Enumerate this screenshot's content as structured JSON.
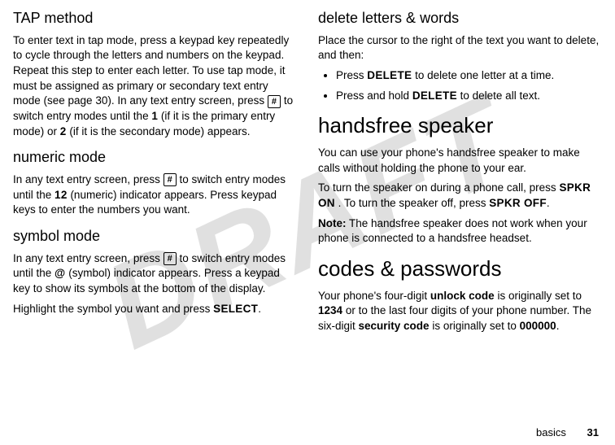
{
  "watermark": "DRAFT",
  "left": {
    "h_tap": "TAP method",
    "tap_para_a": "To enter text in tap mode, press a keypad key repeatedly to cycle through the letters and numbers on the keypad. Repeat this step to enter each letter. To use tap mode, it must be assigned as primary or secondary text entry mode (see page 30). In any text entry screen, press ",
    "key_hash": "#",
    "tap_para_b": " to switch entry modes until the ",
    "disp_1": "1",
    "tap_para_c": " (if it is the primary entry mode) or ",
    "disp_2": "2",
    "tap_para_d": " (if it is the secondary mode) appears.",
    "h_num": "numeric mode",
    "num_a": "In any text entry screen, press ",
    "num_b": " to switch entry modes until the ",
    "disp_12": "12",
    "num_c": " (numeric) indicator appears. Press keypad keys to enter the numbers you want.",
    "h_sym": "symbol mode",
    "sym_a": "In any text entry screen, press ",
    "sym_b": " to switch entry modes until the ",
    "disp_at": "@",
    "sym_c": " (symbol) indicator appears. Press a keypad key to show its symbols at the bottom of the display.",
    "sym_highlight_a": "Highlight the symbol you want and press ",
    "select_label": "SELECT",
    "sym_highlight_b": "."
  },
  "right": {
    "h_del": "delete letters & words",
    "del_intro": "Place the cursor to the right of the text you want to delete, and then:",
    "bullet1_a": "Press ",
    "delete_label": "DELETE",
    "bullet1_b": " to delete one letter at a time.",
    "bullet2_a": "Press and hold ",
    "bullet2_b": " to delete all text.",
    "h_hf": "handsfree speaker",
    "hf_p1": "You can use your phone's handsfree speaker to make calls without holding the phone to your ear.",
    "hf_p2_a": "To turn the speaker on during a phone call, press ",
    "spkr_on": "SPKR ON",
    "hf_p2_b": ". To turn the speaker off, press ",
    "spkr_off": "SPKR OFF",
    "hf_p2_c": ".",
    "note_label": "Note:",
    "note_body": " The handsfree speaker does not work when your phone is connected to a handsfree headset.",
    "h_codes": "codes & passwords",
    "codes_a": "Your phone's four-digit ",
    "unlock_code": "unlock code",
    "codes_b": " is originally set to ",
    "code_1234": "1234",
    "codes_c": " or to the last four digits of your phone number. The six-digit ",
    "security_code": "security code",
    "codes_d": " is originally set to ",
    "code_000000": "000000",
    "codes_e": "."
  },
  "footer": {
    "section": "basics",
    "page": "31"
  }
}
